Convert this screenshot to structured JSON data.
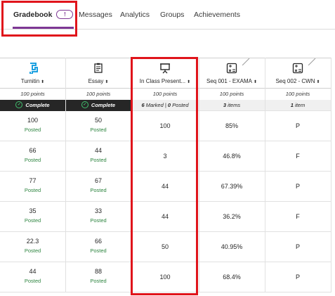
{
  "tabs": [
    {
      "label": "Gradebook",
      "badge": "!"
    },
    {
      "label": "Messages"
    },
    {
      "label": "Analytics"
    },
    {
      "label": "Groups"
    },
    {
      "label": "Achievements"
    }
  ],
  "columns": [
    {
      "title": "Turnitin",
      "icon": "turnitin-icon",
      "points": "100 points",
      "status": "Complete",
      "status_style": "dark"
    },
    {
      "title": "Essay",
      "icon": "assignment-icon",
      "points": "100 points",
      "status": "Complete",
      "status_style": "dark"
    },
    {
      "title": "In Class Present...",
      "icon": "presentation-icon",
      "points": "100 points",
      "status_marked_count": "6",
      "status_marked_label": "Marked",
      "status_sep": "|",
      "status_posted_count": "0",
      "status_posted_label": "Posted",
      "status_style": "light"
    },
    {
      "title": "Seq 001 - EXAMA",
      "icon": "calculated-column-icon",
      "points": "100 points",
      "status_items_count": "3",
      "status_items_label": "items",
      "status_style": "light"
    },
    {
      "title": "Seq 002 - CWN",
      "icon": "calculated-column-icon",
      "points": "100 points",
      "status_items_count": "1",
      "status_items_label": "item",
      "status_style": "light"
    }
  ],
  "sort_glyph": "⬍",
  "rows": [
    {
      "turnitin": "100",
      "turnitin_status": "Posted",
      "essay": "50",
      "essay_status": "Posted",
      "present": "100",
      "seq1": "85%",
      "seq2": "P"
    },
    {
      "turnitin": "66",
      "turnitin_status": "Posted",
      "essay": "44",
      "essay_status": "Posted",
      "present": "3",
      "seq1": "46.8%",
      "seq2": "F"
    },
    {
      "turnitin": "77",
      "turnitin_status": "Posted",
      "essay": "67",
      "essay_status": "Posted",
      "present": "44",
      "seq1": "67.39%",
      "seq2": "P"
    },
    {
      "turnitin": "35",
      "turnitin_status": "Posted",
      "essay": "33",
      "essay_status": "Posted",
      "present": "44",
      "seq1": "36.2%",
      "seq2": "F"
    },
    {
      "turnitin": "22.3",
      "turnitin_status": "Posted",
      "essay": "66",
      "essay_status": "Posted",
      "present": "50",
      "seq1": "40.95%",
      "seq2": "P"
    },
    {
      "turnitin": "44",
      "turnitin_status": "Posted",
      "essay": "88",
      "essay_status": "Posted",
      "present": "100",
      "seq1": "68.4%",
      "seq2": "P"
    }
  ],
  "colors": {
    "accent": "#7e3794",
    "highlight": "#e0141b",
    "posted": "#2e8540",
    "complete_check": "#41c16e",
    "turnitin_blue": "#1ca0e0"
  }
}
